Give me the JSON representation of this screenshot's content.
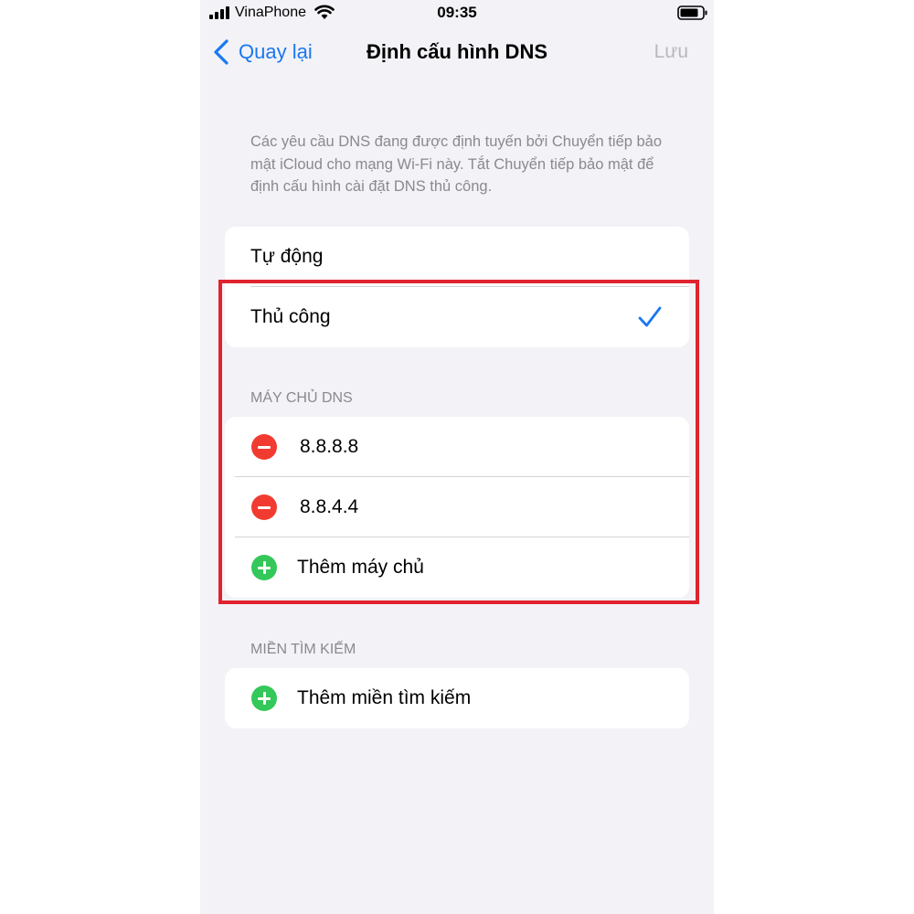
{
  "status_bar": {
    "carrier": "VinaPhone",
    "time": "09:35"
  },
  "nav": {
    "back_label": "Quay lại",
    "title": "Định cấu hình DNS",
    "save_label": "Lưu"
  },
  "info_text": "Các yêu cầu DNS đang được định tuyến bởi Chuyển tiếp bảo mật iCloud cho mạng Wi-Fi này. Tắt Chuyển tiếp bảo mật để định cấu hình cài đặt DNS thủ công.",
  "mode": {
    "options": [
      {
        "label": "Tự động",
        "selected": false
      },
      {
        "label": "Thủ công",
        "selected": true
      }
    ]
  },
  "dns_servers": {
    "header": "MÁY CHỦ DNS",
    "servers": [
      "8.8.8.8",
      "8.8.4.4"
    ],
    "add_label": "Thêm máy chủ"
  },
  "search_domains": {
    "header": "MIỀN TÌM KIẾM",
    "add_label": "Thêm miền tìm kiếm"
  },
  "colors": {
    "accent": "#1a78f0",
    "delete": "#f23b30",
    "add": "#34c759",
    "highlight": "#e0232e"
  }
}
